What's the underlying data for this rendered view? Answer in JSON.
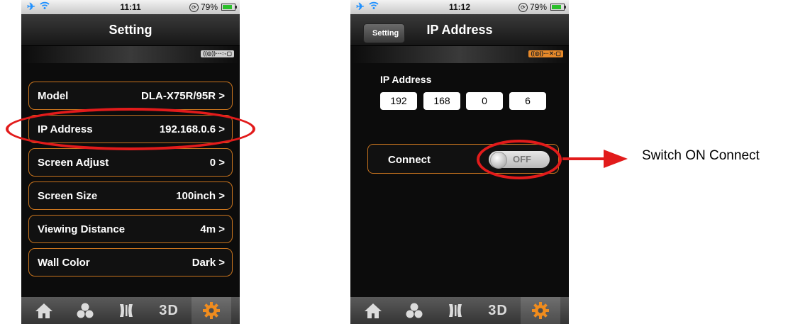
{
  "left_screen": {
    "status": {
      "time": "11:11",
      "battery": "79%"
    },
    "title": "Setting",
    "connection_badge": "((◎))···○-▢",
    "rows": [
      {
        "label": "Model",
        "value": "DLA-X75R/95R >"
      },
      {
        "label": "IP Address",
        "value": "192.168.0.6 >"
      },
      {
        "label": "Screen Adjust",
        "value": "0 >"
      },
      {
        "label": "Screen Size",
        "value": "100inch >"
      },
      {
        "label": "Viewing Distance",
        "value": "4m >"
      },
      {
        "label": "Wall Color",
        "value": "Dark >"
      }
    ],
    "tabs": [
      "home-icon",
      "colors-icon",
      "picture-icon",
      "3D",
      "gear-icon"
    ],
    "active_tab": 4
  },
  "right_screen": {
    "status": {
      "time": "11:12",
      "battery": "79%"
    },
    "title": "IP Address",
    "back_label": "Setting",
    "connection_badge": "((◎))···✕-▢",
    "ip_caption": "IP Address",
    "ip_octets": [
      "192",
      "168",
      "0",
      "6"
    ],
    "connect_label": "Connect",
    "toggle_state": "OFF",
    "tabs": [
      "home-icon",
      "colors-icon",
      "picture-icon",
      "3D",
      "gear-icon"
    ],
    "active_tab": 4
  },
  "annotation": {
    "callout_text": "Switch ON Connect",
    "color": "#e21b1b"
  },
  "colors": {
    "accent": "#c8741e",
    "active_tab": "#f08c1e",
    "screen_bg": "#0c0c0c"
  }
}
